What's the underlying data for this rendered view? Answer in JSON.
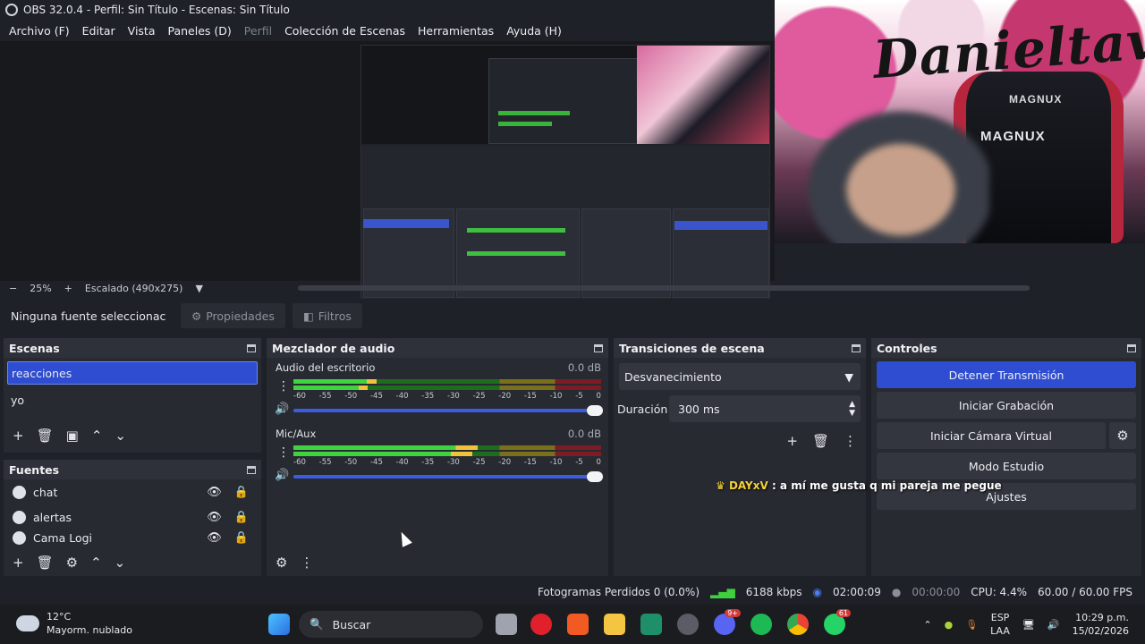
{
  "window": {
    "title": "OBS 32.0.4 - Perfil: Sin Título - Escenas: Sin Título"
  },
  "menu": [
    "Archivo (F)",
    "Editar",
    "Vista",
    "Paneles (D)",
    "Perfil",
    "Colección de Escenas",
    "Herramientas",
    "Ayuda (H)"
  ],
  "zoom": {
    "minus": "−",
    "level": "25%",
    "plus": "+",
    "scaling": "Escalado (490x275)"
  },
  "source_toolbar": {
    "no_selection": "Ninguna fuente seleccionac",
    "properties": "Propiedades",
    "filters": "Filtros"
  },
  "scenes": {
    "title": "Escenas",
    "items": [
      "reacciones",
      "yo"
    ],
    "selected": "reacciones"
  },
  "sources": {
    "title": "Fuentes",
    "items": [
      {
        "name": "chat",
        "locked": false
      },
      {
        "name": "alertas",
        "locked": true
      },
      {
        "name": "Cama Logi",
        "locked": false
      }
    ]
  },
  "mixer": {
    "title": "Mezclador de audio",
    "channels": [
      {
        "name": "Audio del escritorio",
        "db": "0.0 dB",
        "level": 0.27
      },
      {
        "name": "Mic/Aux",
        "db": "0.0 dB",
        "level": 0.6
      }
    ],
    "ticks": [
      "-60",
      "-55",
      "-50",
      "-45",
      "-40",
      "-35",
      "-30",
      "-25",
      "-20",
      "-15",
      "-10",
      "-5",
      "0"
    ]
  },
  "transitions": {
    "title": "Transiciones de escena",
    "selected": "Desvanecimiento",
    "duration_label": "Duración",
    "duration_value": "300 ms"
  },
  "controls": {
    "title": "Controles",
    "stop_stream": "Detener Transmisión",
    "start_recording": "Iniciar Grabación",
    "virtual_cam": "Iniciar Cámara Virtual",
    "studio_mode": "Modo Estudio",
    "settings": "Ajustes"
  },
  "chat_overlay": {
    "user": "DAYxV",
    "message": " : a mí me gusta q mi pareja me pegue"
  },
  "status": {
    "dropped": "Fotogramas Perdidos 0 (0.0%)",
    "bitrate": "6188 kbps",
    "stream_time": "02:00:09",
    "rec_time": "00:00:00",
    "cpu": "CPU: 4.4%",
    "fps": "60.00 / 60.00 FPS"
  },
  "camera_overlay": {
    "graffiti": "Danieltav",
    "chair_brand": "MAGNUX"
  },
  "taskbar": {
    "weather_temp": "12°C",
    "weather_desc": "Mayorm. nublado",
    "search": "Buscar",
    "lang": "ESP",
    "layout": "LAA",
    "time": "10:29 p.m.",
    "date": "15/02/2026",
    "badge_discord": "9+",
    "badge_whatsapp": "61"
  },
  "colors": {
    "accent": "#2f4dd0",
    "panel": "#272a31",
    "bg": "#1f2128"
  }
}
